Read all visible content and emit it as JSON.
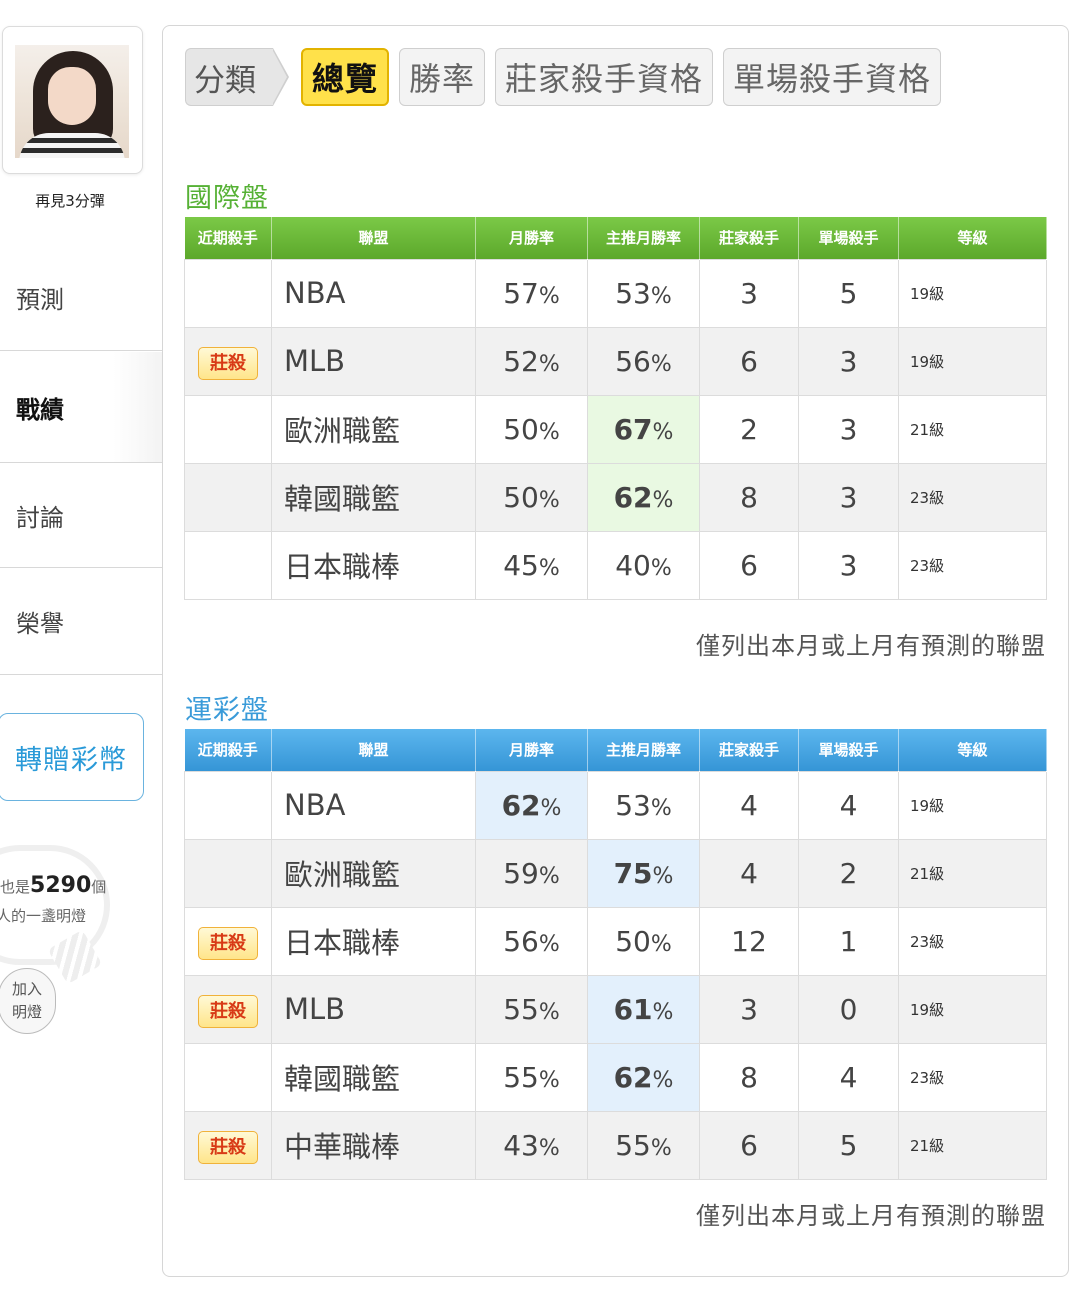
{
  "sidebar": {
    "username": "再見3分彈",
    "nav": [
      "預測",
      "戰績",
      "討論",
      "榮譽"
    ],
    "gift_button": "轉贈彩幣",
    "lamp": {
      "prefix": "也是",
      "count": "5290",
      "suffix": "個",
      "line2": "人的一盞明燈",
      "join_line1": "加入",
      "join_line2": "明燈"
    }
  },
  "tabs": {
    "category": "分類",
    "items": [
      "總覽",
      "勝率",
      "莊家殺手資格",
      "單場殺手資格"
    ],
    "active": "總覽"
  },
  "headers": [
    "近期殺手",
    "聯盟",
    "月勝率",
    "主推月勝率",
    "莊家殺手",
    "單場殺手",
    "等級"
  ],
  "international": {
    "title": "國際盤",
    "rows": [
      {
        "badge": "",
        "league": "NBA",
        "win": "57",
        "main": "53",
        "banker": "3",
        "single": "5",
        "level": "19級"
      },
      {
        "badge": "莊殺",
        "league": "MLB",
        "win": "52",
        "main": "56",
        "banker": "6",
        "single": "3",
        "level": "19級"
      },
      {
        "badge": "",
        "league": "歐洲職籃",
        "win": "50",
        "main": "67",
        "banker": "2",
        "single": "3",
        "level": "21級"
      },
      {
        "badge": "",
        "league": "韓國職籃",
        "win": "50",
        "main": "62",
        "banker": "8",
        "single": "3",
        "level": "23級"
      },
      {
        "badge": "",
        "league": "日本職棒",
        "win": "45",
        "main": "40",
        "banker": "6",
        "single": "3",
        "level": "23級"
      }
    ],
    "note": "僅列出本月或上月有預測的聯盟"
  },
  "sports_lottery": {
    "title": "運彩盤",
    "rows": [
      {
        "badge": "",
        "league": "NBA",
        "win": "62",
        "main": "53",
        "banker": "4",
        "single": "4",
        "level": "19級"
      },
      {
        "badge": "",
        "league": "歐洲職籃",
        "win": "59",
        "main": "75",
        "banker": "4",
        "single": "2",
        "level": "21級"
      },
      {
        "badge": "莊殺",
        "league": "日本職棒",
        "win": "56",
        "main": "50",
        "banker": "12",
        "single": "1",
        "level": "23級"
      },
      {
        "badge": "莊殺",
        "league": "MLB",
        "win": "55",
        "main": "61",
        "banker": "3",
        "single": "0",
        "level": "19級"
      },
      {
        "badge": "",
        "league": "韓國職籃",
        "win": "55",
        "main": "62",
        "banker": "8",
        "single": "4",
        "level": "23級"
      },
      {
        "badge": "莊殺",
        "league": "中華職棒",
        "win": "43",
        "main": "55",
        "banker": "6",
        "single": "5",
        "level": "21級"
      }
    ],
    "note": "僅列出本月或上月有預測的聯盟"
  },
  "pct_symbol": "%",
  "colors": {
    "green_header": "#5ca82b",
    "blue_header": "#3595d6",
    "active_tab": "#ffe14a",
    "badge_text": "#d83a16",
    "green_highlight": "#e9f9e2",
    "blue_highlight": "#e3f0fc"
  }
}
